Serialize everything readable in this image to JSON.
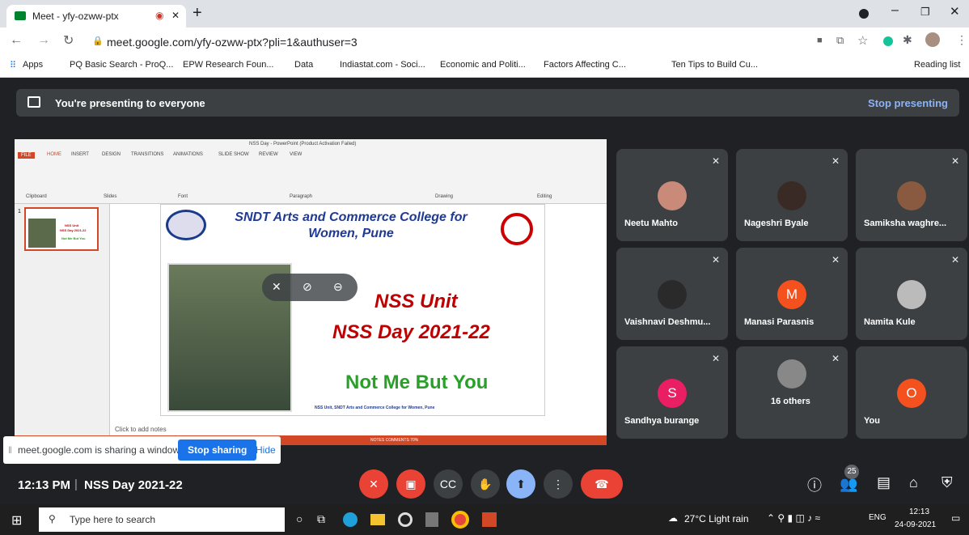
{
  "browser": {
    "tab_title": "Meet - yfy-ozww-ptx",
    "new_tab": "+",
    "url": "meet.google.com/yfy-ozww-ptx?pli=1&authuser=3",
    "bookmarks": [
      "Apps",
      "PQ Basic Search - ProQ...",
      "EPW Research Foun...",
      "Data",
      "Indiastat.com - Soci...",
      "Economic and Politi...",
      "Factors Affecting C...",
      "Ten Tips to Build Cu..."
    ],
    "reading_list": "Reading list"
  },
  "presenting": {
    "message": "You're presenting to everyone",
    "stop": "Stop presenting"
  },
  "ppt": {
    "title_bar": "NSS Day - PowerPoint (Product Activation Failed)",
    "tabs": [
      "FILE",
      "HOME",
      "INSERT",
      "DESIGN",
      "TRANSITIONS",
      "ANIMATIONS",
      "SLIDE SHOW",
      "REVIEW",
      "VIEW"
    ],
    "groups": [
      "Clipboard",
      "Slides",
      "Font",
      "Paragraph",
      "Drawing",
      "Editing"
    ],
    "notes": "Click to add notes",
    "status": "NOTES   COMMENTS        70%",
    "slide": {
      "college": "SNDT Arts and Commerce College for Women, Pune",
      "unit": "NSS Unit",
      "day": "NSS Day 2021-22",
      "motto": "Not Me But You",
      "footer": "NSS Unit, SNDT Arts and Commerce College for Women, Pune"
    },
    "thumb": {
      "num": "1",
      "l1": "NSS Unit",
      "l2": "NSS Day 2021-22",
      "l3": "Not Me But You"
    }
  },
  "participants": [
    {
      "name": "Neetu Mahto",
      "color": "#c98a7a"
    },
    {
      "name": "Nageshri Byale",
      "color": "#3a2a26"
    },
    {
      "name": "Samiksha waghre...",
      "color": "#8a5a40"
    },
    {
      "name": "Vaishnavi Deshmu...",
      "color": "#2a2a2a"
    },
    {
      "name": "Manasi Parasnis",
      "initial": "M",
      "color": "#f4511e"
    },
    {
      "name": "Namita Kule",
      "color": "#bbbbbb"
    },
    {
      "name": "Sandhya burange",
      "initial": "S",
      "color": "#e91e63"
    },
    {
      "name": "16 others",
      "color": "#888"
    },
    {
      "name": "You",
      "initial": "O",
      "color": "#f4511e"
    }
  ],
  "sharing": {
    "text": "meet.google.com is sharing a window.",
    "stop": "Stop sharing",
    "hide": "Hide"
  },
  "meeting": {
    "time": "12:13 PM",
    "sep": "|",
    "name": "NSS Day 2021-22",
    "people_count": "25"
  },
  "taskbar": {
    "search": "Type here to search",
    "weather": "27°C  Light rain",
    "lang": "ENG",
    "time": "12:13",
    "date": "24-09-2021"
  }
}
